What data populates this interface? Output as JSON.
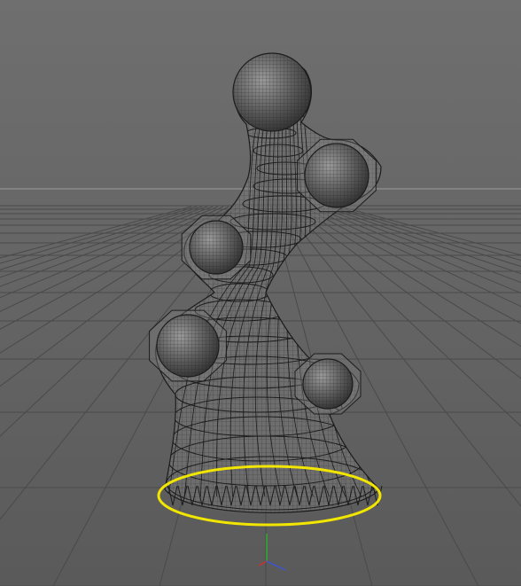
{
  "viewport": {
    "background_top": "#6f6f6f",
    "background_bottom": "#5a5a5a",
    "horizon_color": "#8a8a8a",
    "grid_color": "#4a4a4a",
    "mesh_color": "#1c1c1c",
    "mesh_fill": "#7a7a7a",
    "selection_color": "#f2e600"
  },
  "axis_gizmo": {
    "x_color": "#d03030",
    "y_color": "#2fb52f",
    "z_color": "#3a55d8"
  },
  "objects": [
    {
      "name": "sweep-surface",
      "type": "wireframe-mesh"
    },
    {
      "name": "top-sphere",
      "type": "sphere"
    },
    {
      "name": "upper-right-sphere",
      "type": "sphere"
    },
    {
      "name": "middle-left-sphere",
      "type": "sphere"
    },
    {
      "name": "lower-left-sphere",
      "type": "sphere"
    },
    {
      "name": "lower-right-sphere",
      "type": "sphere"
    },
    {
      "name": "base-circle-spline",
      "type": "spline",
      "selected": true
    }
  ]
}
